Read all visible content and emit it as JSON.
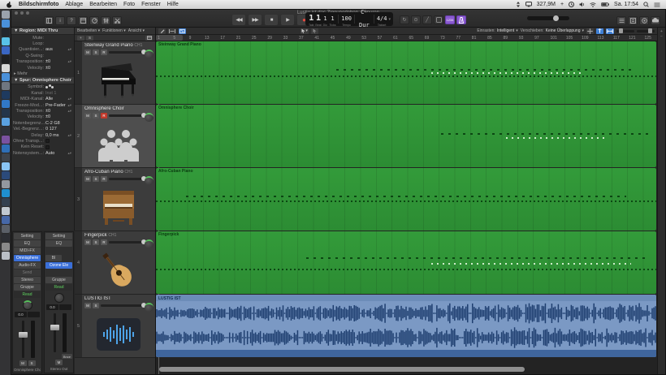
{
  "menu_bar": {
    "app_name": "Bildschirmfoto",
    "menus": [
      "Ablage",
      "Bearbeiten",
      "Foto",
      "Fenster",
      "Hilfe"
    ],
    "status": {
      "memory": "327,9M",
      "clock": "Sa. 17:54"
    }
  },
  "window": {
    "title": "Lustig ist das Zigeunerleben – Spuren"
  },
  "lcd": {
    "bar": "1",
    "beat": "1",
    "div": "1",
    "tick": "1",
    "bar_label": "Takt",
    "beat_label": "Beat",
    "div_label": "Div.",
    "tick_label": "Ticks",
    "tempo": "100",
    "tempo_label": "Tempo",
    "key": "C-Dur",
    "key_label": "Tonart",
    "time_sig": "4/4",
    "time_label": "Taktart"
  },
  "count_in_label": "1234",
  "tracks_toolbar": {
    "menus": [
      "Bearbeiten",
      "Funktionen",
      "Ansicht"
    ],
    "snap_label": "Einrasten:",
    "snap_value": "Intelligent",
    "drag_label": "Verschieben:",
    "drag_value": "Keine Überlappung"
  },
  "header_toolbar": {
    "add_button": "+",
    "solo_button": "S"
  },
  "ruler": {
    "labels": [
      1,
      5,
      9,
      13,
      17,
      21,
      25,
      29,
      33,
      37,
      41,
      45,
      49,
      53,
      57,
      61,
      65,
      69,
      73,
      77,
      81,
      85,
      89,
      93,
      97,
      101,
      105,
      109,
      113,
      117,
      121,
      125
    ]
  },
  "tracks": [
    {
      "num": "1",
      "name": "Steinway Grand Piano",
      "suffix": "CH1",
      "mute": "M",
      "solo": "S",
      "rec": "R"
    },
    {
      "num": "2",
      "name": "Omnisphere Choir",
      "suffix": "",
      "mute": "M",
      "solo": "S",
      "rec": "R"
    },
    {
      "num": "3",
      "name": "Afro-Cuban Piano",
      "suffix": "CH1",
      "mute": "M",
      "solo": "S",
      "rec": "R"
    },
    {
      "num": "4",
      "name": "Fingerpick",
      "suffix": "CH1",
      "mute": "M",
      "solo": "S",
      "rec": "R"
    },
    {
      "num": "5",
      "name": "LUSTIG IST",
      "suffix": "",
      "mute": "M",
      "solo": "S",
      "rec": ""
    }
  ],
  "regions": [
    {
      "label": "Steinway Grand Piano",
      "type": "midi"
    },
    {
      "label": "Omnisphere Choir",
      "type": "midi"
    },
    {
      "label": "Afro-Cuban Piano",
      "type": "midi"
    },
    {
      "label": "Fingerpick",
      "type": "midi"
    },
    {
      "label": "LUSTIG IST",
      "type": "audio"
    }
  ],
  "inspector": {
    "region_header": "Region: MIDI Thru",
    "region_params": [
      {
        "label": "Mute:",
        "value": ""
      },
      {
        "label": "Loop:",
        "value": ""
      },
      {
        "label": "Quantisier...:",
        "value": "aus",
        "stepper": true
      },
      {
        "label": "Q-Swing:",
        "value": "",
        "dim": true
      },
      {
        "label": "Transposition:",
        "value": "±0",
        "stepper": true
      },
      {
        "label": "Velocity:",
        "value": "±0"
      }
    ],
    "more_label": "Mehr",
    "track_header": "Spur: Omnisphere Choir",
    "track_params": [
      {
        "label": "Symbol:",
        "icon": "choir"
      },
      {
        "label": "Kanal:",
        "value": "Inst 1",
        "dim": true
      },
      {
        "label": "MIDI-Kanal:",
        "value": "Alle",
        "stepper": true
      },
      {
        "label": "Freeze-Mod...:",
        "value": "Pre-Fader",
        "stepper": true
      },
      {
        "label": "Transposition:",
        "value": "±0",
        "stepper": true
      },
      {
        "label": "Velocity:",
        "value": "±0"
      },
      {
        "label": "Notenbegrenz...:",
        "value": "C-2   G8"
      },
      {
        "label": "Vel.-Begrenz...:",
        "value": "0   127"
      },
      {
        "label": "Delay:",
        "value": "0,0 ms",
        "stepper": true
      },
      {
        "label": "Ohne Transp...:",
        "checkbox": true
      },
      {
        "label": "Kein Reset:",
        "checkbox": true
      },
      {
        "label": "Notensystem...:",
        "value": "Auto",
        "stepper": true
      }
    ]
  },
  "strips": [
    {
      "name": "Omnisphere Choir",
      "volume": "0.0",
      "buttons": [
        "M",
        "S"
      ],
      "pan_green": true,
      "slots": [
        {
          "t": "Setting"
        },
        {
          "t": "EQ"
        },
        {
          "t": "MIDI-FX"
        },
        {
          "t": "Omnisphere",
          "style": "blue"
        },
        {
          "t": "Audio-FX"
        },
        {
          "t": "Send",
          "style": "dim"
        },
        {
          "t": "Stereo"
        },
        {
          "t": "Gruppe"
        },
        {
          "t": "Read",
          "style": "green"
        }
      ]
    },
    {
      "name": "Stereo Out",
      "volume": "0.0",
      "buttons": [
        "M"
      ],
      "bounce": "Bnce",
      "pan_green": false,
      "slots": [
        {
          "t": "Setting"
        },
        {
          "t": "EQ"
        },
        {
          "t": "",
          "style": "empty"
        },
        {
          "t": "Bl",
          "style": "small"
        },
        {
          "t": "Ozone Ele",
          "style": "blue"
        },
        {
          "t": "",
          "style": "empty"
        },
        {
          "t": "Gruppe"
        },
        {
          "t": "Read",
          "style": "green"
        }
      ]
    }
  ],
  "dock": {
    "colors": [
      "#9aa2ad",
      "#4a90d9",
      "#23262b",
      "#58c1e8",
      "#3a66c4",
      "#1f2022",
      "#d8d8d8",
      "#4a90d9",
      "#6f7680",
      "#1e3a5f",
      "#3178c6",
      "#24354a",
      "#5aa0e0",
      "#2e3138",
      "#7a52a0",
      "#2f6fb8",
      "#3f444c",
      "#89c4f4",
      "#2b4a7a",
      "#94989f",
      "#1f8fce",
      "#33404f",
      "#c0c8d0",
      "#4668a8",
      "#5b6068",
      "#2d2f34",
      "#8a8a8a",
      "#b9bec6"
    ]
  }
}
